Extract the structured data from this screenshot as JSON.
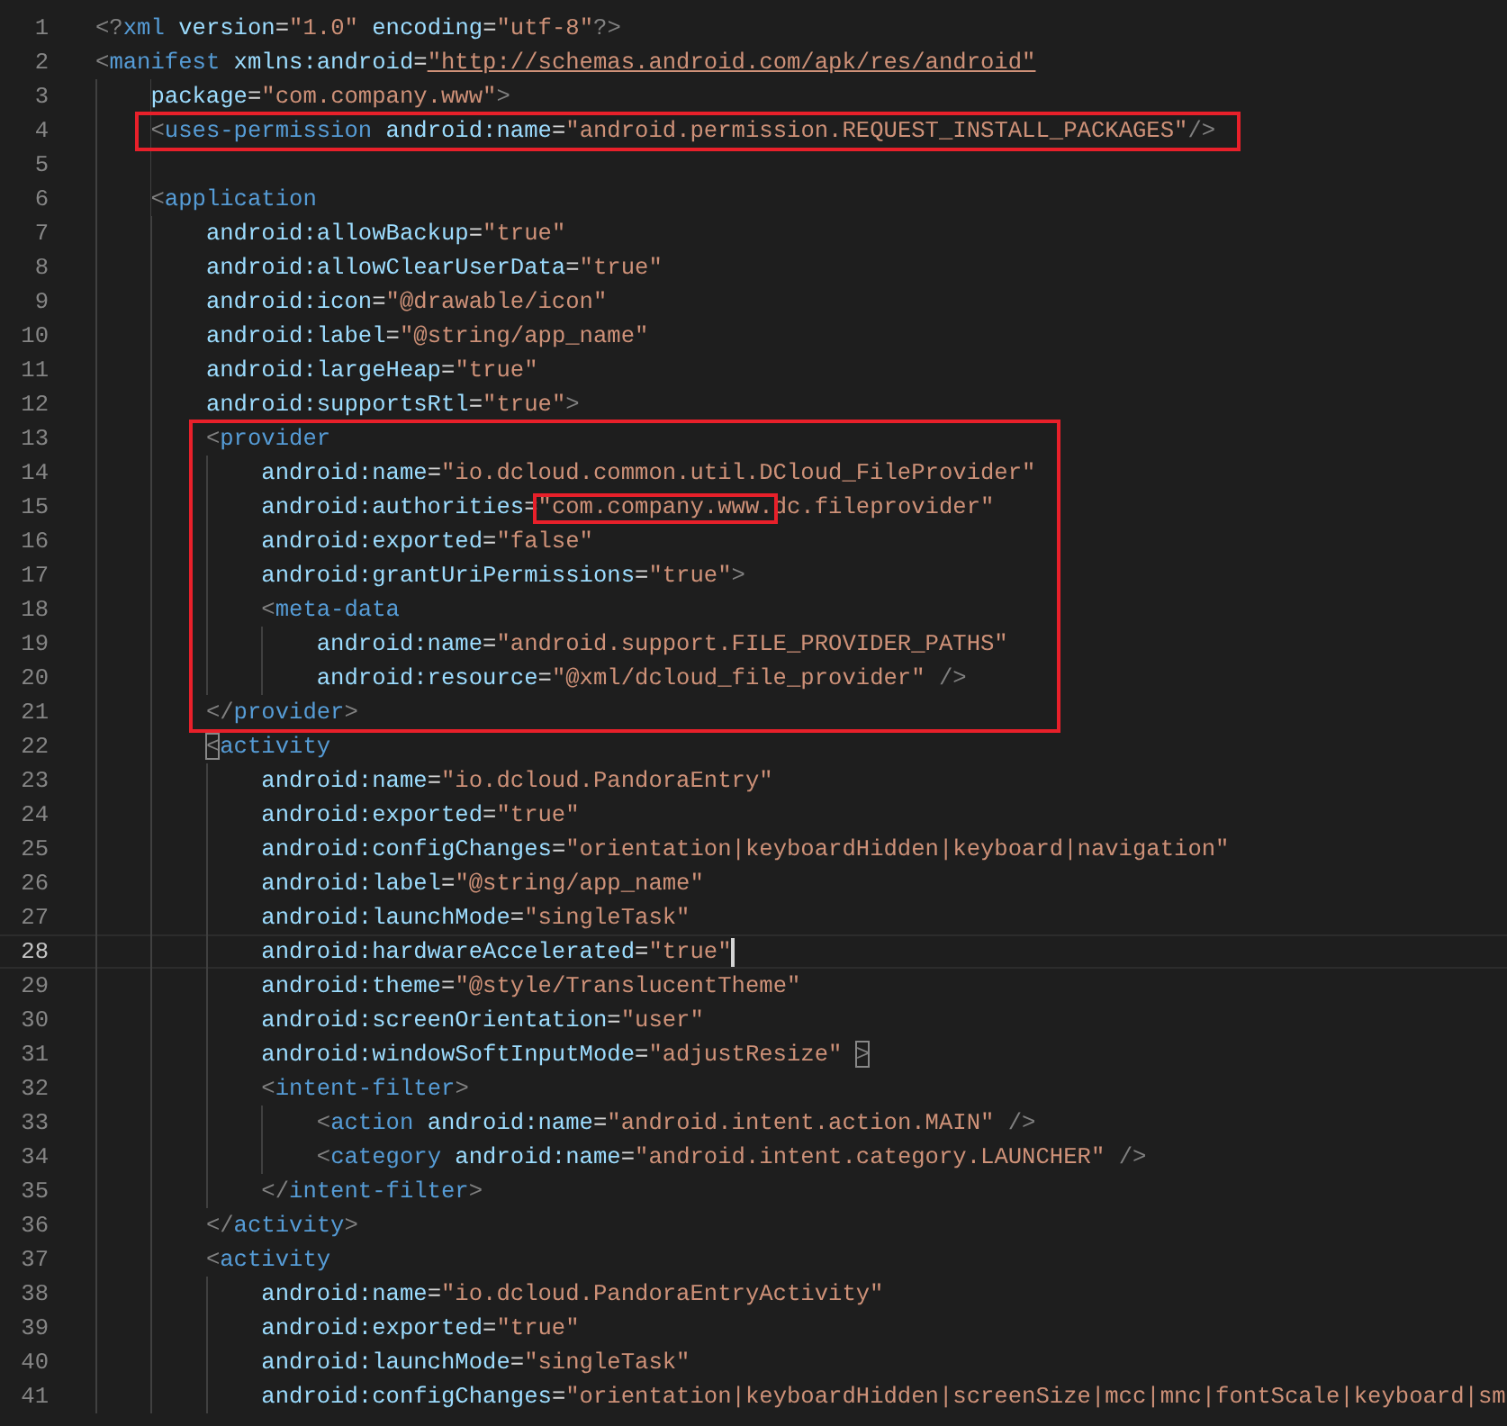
{
  "editor": {
    "lines": [
      {
        "number": "1",
        "tokens": [
          {
            "kind": "punct",
            "text": "<?"
          },
          {
            "kind": "tag",
            "text": "xml"
          },
          {
            "kind": "attr",
            "text": " version"
          },
          {
            "kind": "eq",
            "text": "="
          },
          {
            "kind": "string",
            "text": "\"1.0\""
          },
          {
            "kind": "attr",
            "text": " encoding"
          },
          {
            "kind": "eq",
            "text": "="
          },
          {
            "kind": "string",
            "text": "\"utf-8\""
          },
          {
            "kind": "punct",
            "text": "?>"
          }
        ]
      },
      {
        "number": "2",
        "tokens": [
          {
            "kind": "punct",
            "text": "<"
          },
          {
            "kind": "tag",
            "text": "manifest"
          },
          {
            "kind": "attr",
            "text": " xmlns:android"
          },
          {
            "kind": "eq",
            "text": "="
          },
          {
            "kind": "link",
            "text": "\"http://schemas.android.com/apk/res/android\""
          }
        ],
        "children": [
          {
            "kind": "line",
            "number": "3",
            "tokens": [
              {
                "kind": "attr",
                "text": "package"
              },
              {
                "kind": "eq",
                "text": "="
              },
              {
                "kind": "string",
                "text": "\"com.company.www\""
              },
              {
                "kind": "punct",
                "text": ">"
              }
            ]
          },
          {
            "kind": "highlight",
            "lines": [
              {
                "number": "4",
                "tokens": [
                  {
                    "kind": "punct",
                    "text": "<"
                  },
                  {
                    "kind": "tag",
                    "text": "uses-permission"
                  },
                  {
                    "kind": "attr",
                    "text": " android:name"
                  },
                  {
                    "kind": "eq",
                    "text": "="
                  },
                  {
                    "kind": "string",
                    "text": "\"android.permission.REQUEST_INSTALL_PACKAGES\""
                  },
                  {
                    "kind": "punct",
                    "text": "/>"
                  }
                ]
              }
            ]
          },
          {
            "kind": "line",
            "number": "5"
          },
          {
            "kind": "line",
            "number": "6",
            "tokens": [
              {
                "kind": "punct",
                "text": "<"
              },
              {
                "kind": "tag",
                "text": "application"
              }
            ],
            "children": [
              {
                "kind": "line",
                "number": "7",
                "tokens": [
                  {
                    "kind": "attr",
                    "text": "android:allowBackup"
                  },
                  {
                    "kind": "eq",
                    "text": "="
                  },
                  {
                    "kind": "string",
                    "text": "\"true\""
                  }
                ]
              },
              {
                "kind": "line",
                "number": "8",
                "tokens": [
                  {
                    "kind": "attr",
                    "text": "android:allowClearUserData"
                  },
                  {
                    "kind": "eq",
                    "text": "="
                  },
                  {
                    "kind": "string",
                    "text": "\"true\""
                  }
                ]
              },
              {
                "kind": "line",
                "number": "9",
                "tokens": [
                  {
                    "kind": "attr",
                    "text": "android:icon"
                  },
                  {
                    "kind": "eq",
                    "text": "="
                  },
                  {
                    "kind": "string",
                    "text": "\"@drawable/icon\""
                  }
                ]
              },
              {
                "kind": "line",
                "number": "10",
                "tokens": [
                  {
                    "kind": "attr",
                    "text": "android:label"
                  },
                  {
                    "kind": "eq",
                    "text": "="
                  },
                  {
                    "kind": "string",
                    "text": "\"@string/app_name\""
                  }
                ]
              },
              {
                "kind": "line",
                "number": "11",
                "tokens": [
                  {
                    "kind": "attr",
                    "text": "android:largeHeap"
                  },
                  {
                    "kind": "eq",
                    "text": "="
                  },
                  {
                    "kind": "string",
                    "text": "\"true\""
                  }
                ]
              },
              {
                "kind": "line",
                "number": "12",
                "tokens": [
                  {
                    "kind": "attr",
                    "text": "android:supportsRtl"
                  },
                  {
                    "kind": "eq",
                    "text": "="
                  },
                  {
                    "kind": "string",
                    "text": "\"true\""
                  },
                  {
                    "kind": "punct",
                    "text": ">"
                  }
                ]
              },
              {
                "kind": "highlight",
                "lines": [
                  {
                    "number": "13",
                    "tokens": [
                      {
                        "kind": "punct",
                        "text": "<"
                      },
                      {
                        "kind": "tag",
                        "text": "provider"
                      }
                    ],
                    "children": [
                      {
                        "number": "14",
                        "tokens": [
                          {
                            "kind": "attr",
                            "text": "android:name"
                          },
                          {
                            "kind": "eq",
                            "text": "="
                          },
                          {
                            "kind": "string",
                            "text": "\"io.dcloud.common.util.DCloud_FileProvider\""
                          }
                        ]
                      },
                      {
                        "number": "15",
                        "tokens": [
                          {
                            "kind": "attr",
                            "text": "android:authorities"
                          },
                          {
                            "kind": "eq",
                            "text": "="
                          },
                          {
                            "kind": "string",
                            "text": "\"com.company.www.",
                            "boxed": true
                          },
                          {
                            "kind": "string",
                            "text": "dc.fileprovider\""
                          }
                        ]
                      },
                      {
                        "number": "16",
                        "tokens": [
                          {
                            "kind": "attr",
                            "text": "android:exported"
                          },
                          {
                            "kind": "eq",
                            "text": "="
                          },
                          {
                            "kind": "string",
                            "text": "\"false\""
                          }
                        ]
                      },
                      {
                        "number": "17",
                        "tokens": [
                          {
                            "kind": "attr",
                            "text": "android:grantUriPermissions"
                          },
                          {
                            "kind": "eq",
                            "text": "="
                          },
                          {
                            "kind": "string",
                            "text": "\"true\""
                          },
                          {
                            "kind": "punct",
                            "text": ">"
                          }
                        ]
                      },
                      {
                        "number": "18",
                        "tokens": [
                          {
                            "kind": "punct",
                            "text": "<"
                          },
                          {
                            "kind": "tag",
                            "text": "meta-data"
                          }
                        ],
                        "children": [
                          {
                            "number": "19",
                            "tokens": [
                              {
                                "kind": "attr",
                                "text": "android:name"
                              },
                              {
                                "kind": "eq",
                                "text": "="
                              },
                              {
                                "kind": "string",
                                "text": "\"android.support.FILE_PROVIDER_PATHS\""
                              }
                            ]
                          },
                          {
                            "number": "20",
                            "tokens": [
                              {
                                "kind": "attr",
                                "text": "android:resource"
                              },
                              {
                                "kind": "eq",
                                "text": "="
                              },
                              {
                                "kind": "string",
                                "text": "\"@xml/dcloud_file_provider\""
                              },
                              {
                                "kind": "punct",
                                "text": " />"
                              }
                            ]
                          }
                        ]
                      }
                    ]
                  },
                  {
                    "number": "21",
                    "tokens": [
                      {
                        "kind": "punct",
                        "text": "</"
                      },
                      {
                        "kind": "tag",
                        "text": "provider"
                      },
                      {
                        "kind": "punct",
                        "text": ">"
                      }
                    ]
                  }
                ]
              },
              {
                "kind": "line",
                "number": "22",
                "tokens": [
                  {
                    "kind": "punct",
                    "text": "<",
                    "matched": true
                  },
                  {
                    "kind": "tag",
                    "text": "activity"
                  }
                ],
                "children": [
                  {
                    "number": "23",
                    "tokens": [
                      {
                        "kind": "attr",
                        "text": "android:name"
                      },
                      {
                        "kind": "eq",
                        "text": "="
                      },
                      {
                        "kind": "string",
                        "text": "\"io.dcloud.PandoraEntry\""
                      }
                    ]
                  },
                  {
                    "number": "24",
                    "tokens": [
                      {
                        "kind": "attr",
                        "text": "android:exported"
                      },
                      {
                        "kind": "eq",
                        "text": "="
                      },
                      {
                        "kind": "string",
                        "text": "\"true\""
                      }
                    ]
                  },
                  {
                    "number": "25",
                    "tokens": [
                      {
                        "kind": "attr",
                        "text": "android:configChanges"
                      },
                      {
                        "kind": "eq",
                        "text": "="
                      },
                      {
                        "kind": "string",
                        "text": "\"orientation|keyboardHidden|keyboard|navigation\""
                      }
                    ]
                  },
                  {
                    "number": "26",
                    "tokens": [
                      {
                        "kind": "attr",
                        "text": "android:label"
                      },
                      {
                        "kind": "eq",
                        "text": "="
                      },
                      {
                        "kind": "string",
                        "text": "\"@string/app_name\""
                      }
                    ]
                  },
                  {
                    "number": "27",
                    "tokens": [
                      {
                        "kind": "attr",
                        "text": "android:launchMode"
                      },
                      {
                        "kind": "eq",
                        "text": "="
                      },
                      {
                        "kind": "string",
                        "text": "\"singleTask\""
                      }
                    ]
                  },
                  {
                    "number": "28",
                    "current": true,
                    "tokens": [
                      {
                        "kind": "attr",
                        "text": "android:hardwareAccelerated"
                      },
                      {
                        "kind": "eq",
                        "text": "="
                      },
                      {
                        "kind": "string",
                        "text": "\"true\""
                      }
                    ]
                  },
                  {
                    "number": "29",
                    "tokens": [
                      {
                        "kind": "attr",
                        "text": "android:theme"
                      },
                      {
                        "kind": "eq",
                        "text": "="
                      },
                      {
                        "kind": "string",
                        "text": "\"@style/TranslucentTheme\""
                      }
                    ]
                  },
                  {
                    "number": "30",
                    "tokens": [
                      {
                        "kind": "attr",
                        "text": "android:screenOrientation"
                      },
                      {
                        "kind": "eq",
                        "text": "="
                      },
                      {
                        "kind": "string",
                        "text": "\"user\""
                      }
                    ]
                  },
                  {
                    "number": "31",
                    "tokens": [
                      {
                        "kind": "attr",
                        "text": "android:windowSoftInputMode"
                      },
                      {
                        "kind": "eq",
                        "text": "="
                      },
                      {
                        "kind": "string",
                        "text": "\"adjustResize\" "
                      },
                      {
                        "kind": "punct",
                        "text": ">",
                        "matched": true
                      }
                    ]
                  },
                  {
                    "number": "32",
                    "tokens": [
                      {
                        "kind": "punct",
                        "text": "<"
                      },
                      {
                        "kind": "tag",
                        "text": "intent-filter"
                      },
                      {
                        "kind": "punct",
                        "text": ">"
                      }
                    ],
                    "children": [
                      {
                        "number": "33",
                        "tokens": [
                          {
                            "kind": "punct",
                            "text": "<"
                          },
                          {
                            "kind": "tag",
                            "text": "action"
                          },
                          {
                            "kind": "attr",
                            "text": " android:name"
                          },
                          {
                            "kind": "eq",
                            "text": "="
                          },
                          {
                            "kind": "string",
                            "text": "\"android.intent.action.MAIN\""
                          },
                          {
                            "kind": "punct",
                            "text": " />"
                          }
                        ]
                      },
                      {
                        "number": "34",
                        "tokens": [
                          {
                            "kind": "punct",
                            "text": "<"
                          },
                          {
                            "kind": "tag",
                            "text": "category"
                          },
                          {
                            "kind": "attr",
                            "text": " android:name"
                          },
                          {
                            "kind": "eq",
                            "text": "="
                          },
                          {
                            "kind": "string",
                            "text": "\"android.intent.category.LAUNCHER\""
                          },
                          {
                            "kind": "punct",
                            "text": " />"
                          }
                        ]
                      }
                    ]
                  },
                  {
                    "number": "35",
                    "tokens": [
                      {
                        "kind": "punct",
                        "text": "</"
                      },
                      {
                        "kind": "tag",
                        "text": "intent-filter"
                      },
                      {
                        "kind": "punct",
                        "text": ">"
                      }
                    ]
                  }
                ]
              },
              {
                "kind": "line",
                "number": "36",
                "tokens": [
                  {
                    "kind": "punct",
                    "text": "</"
                  },
                  {
                    "kind": "tag",
                    "text": "activity"
                  },
                  {
                    "kind": "punct",
                    "text": ">"
                  }
                ]
              },
              {
                "kind": "line",
                "number": "37",
                "tokens": [
                  {
                    "kind": "punct",
                    "text": "<"
                  },
                  {
                    "kind": "tag",
                    "text": "activity"
                  }
                ],
                "children": [
                  {
                    "number": "38",
                    "tokens": [
                      {
                        "kind": "attr",
                        "text": "android:name"
                      },
                      {
                        "kind": "eq",
                        "text": "="
                      },
                      {
                        "kind": "string",
                        "text": "\"io.dcloud.PandoraEntryActivity\""
                      }
                    ]
                  },
                  {
                    "number": "39",
                    "tokens": [
                      {
                        "kind": "attr",
                        "text": "android:exported"
                      },
                      {
                        "kind": "eq",
                        "text": "="
                      },
                      {
                        "kind": "string",
                        "text": "\"true\""
                      }
                    ]
                  },
                  {
                    "number": "40",
                    "tokens": [
                      {
                        "kind": "attr",
                        "text": "android:launchMode"
                      },
                      {
                        "kind": "eq",
                        "text": "="
                      },
                      {
                        "kind": "string",
                        "text": "\"singleTask\""
                      }
                    ]
                  },
                  {
                    "number": "41",
                    "tokens": [
                      {
                        "kind": "attr",
                        "text": "android:configChanges"
                      },
                      {
                        "kind": "eq",
                        "text": "="
                      },
                      {
                        "kind": "string",
                        "text": "\"orientation|keyboardHidden|screenSize|mcc|mnc|fontScale|keyboard|sm"
                      }
                    ]
                  }
                ]
              }
            ]
          }
        ]
      }
    ]
  }
}
